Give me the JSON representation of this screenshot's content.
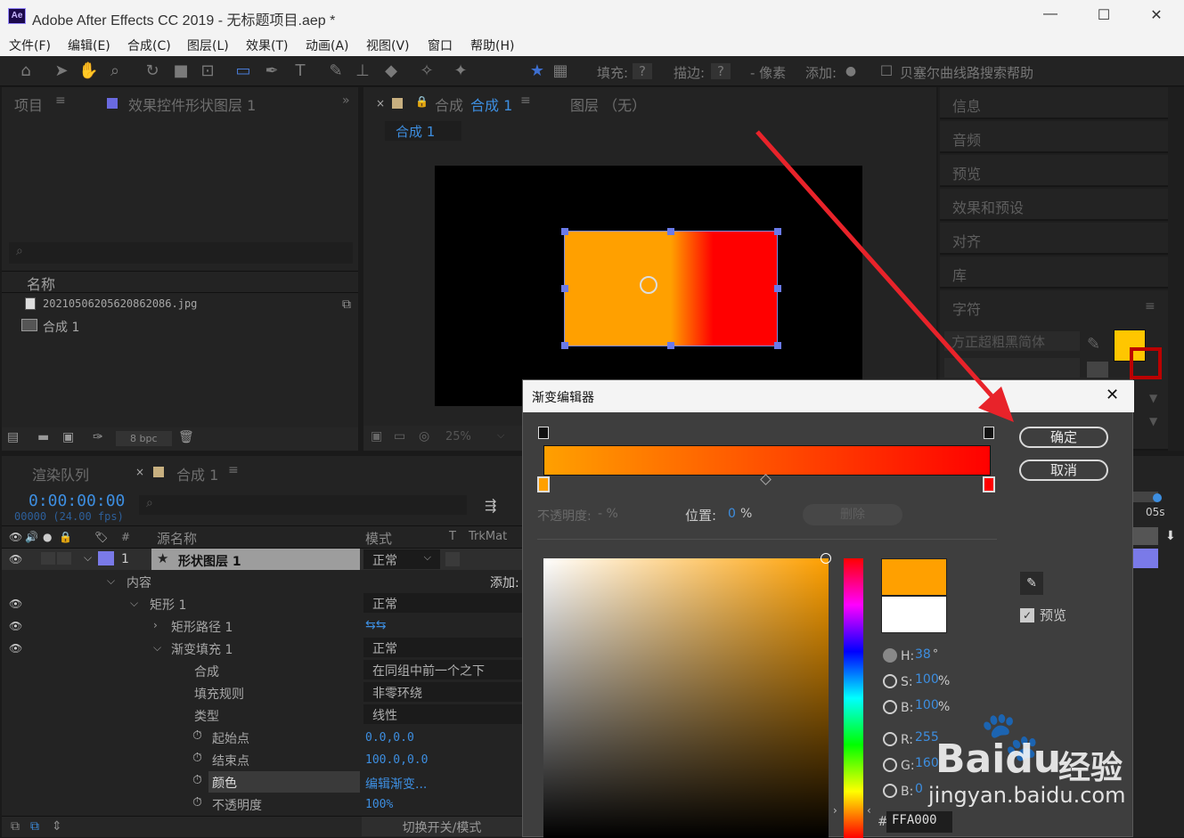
{
  "window": {
    "title": "Adobe After Effects CC 2019 - 无标题项目.aep *",
    "logo": "Ae"
  },
  "menu": [
    "文件(F)",
    "编辑(E)",
    "合成(C)",
    "图层(L)",
    "效果(T)",
    "动画(A)",
    "视图(V)",
    "窗口",
    "帮助(H)"
  ],
  "toolbar": {
    "fill_label": "填充:",
    "fill_value": "?",
    "stroke_label": "描边:",
    "stroke_value": "?",
    "px_label": "- 像素",
    "add_label": "添加:",
    "bezier": "贝塞尔曲线路",
    "search": "搜索帮助"
  },
  "project_panel": {
    "tab_project": "项目",
    "tab_effects": "效果控件形状图层 1",
    "col_name": "名称",
    "items": [
      {
        "name": "20210506205620862086.jpg"
      },
      {
        "name": "合成 1"
      }
    ],
    "bpc": "8 bpc"
  },
  "comp_panel": {
    "tab": "合成",
    "tab_name": "合成 1",
    "layer_tab": "图层 （无）",
    "breadcrumb": "合成 1",
    "zoom": "25%"
  },
  "right_panels": [
    "信息",
    "音频",
    "预览",
    "效果和预设",
    "对齐",
    "库",
    "字符"
  ],
  "character": {
    "font": "方正超粗黑简体"
  },
  "timeline": {
    "tab_render": "渲染队列",
    "tab_comp": "合成 1",
    "timecode": "0:00:00:00",
    "frame_info": "00000 (24.00 fps)",
    "col_source": "源名称",
    "col_mode": "模式",
    "col_t": "T",
    "col_trkmat": "TrkMat",
    "time_label": "05s",
    "bottom_label": "切换开关/模式",
    "layer": {
      "num": "1",
      "name": "形状图层 1",
      "mode": "正常"
    },
    "rows": [
      {
        "label": "内容",
        "value": "添加:"
      },
      {
        "label": "矩形 1",
        "value": "正常"
      },
      {
        "label": "矩形路径 1",
        "value": ""
      },
      {
        "label": "渐变填充 1",
        "value": "正常"
      },
      {
        "label": "合成",
        "value": "在同组中前一个之下"
      },
      {
        "label": "填充规则",
        "value": "非零环绕"
      },
      {
        "label": "类型",
        "value": "线性"
      },
      {
        "label": "起始点",
        "value": "0.0,0.0"
      },
      {
        "label": "结束点",
        "value": "100.0,0.0"
      },
      {
        "label": "颜色",
        "value": "编辑渐变..."
      },
      {
        "label": "不透明度",
        "value": "100%"
      }
    ]
  },
  "gradient_editor": {
    "title": "渐变编辑器",
    "ok": "确定",
    "cancel": "取消",
    "opacity_label": "不透明度:",
    "opacity_value": "- %",
    "position_label": "位置:",
    "position_value": "0",
    "position_unit": "%",
    "delete": "删除",
    "preview_label": "预览",
    "hsb": {
      "h_label": "H:",
      "h": "38",
      "h_unit": "°",
      "s_label": "S:",
      "s": "100",
      "s_unit": "%",
      "b_label": "B:",
      "b": "100",
      "b_unit": "%"
    },
    "rgb": {
      "r_label": "R:",
      "r": "255",
      "g_label": "G:",
      "g": "160",
      "b_label": "B:",
      "b": "0"
    },
    "hex_label": "#",
    "hex": "FFA000"
  },
  "colors": {
    "orange": "#FFA000",
    "red": "#FF0000",
    "accent": "#3d8ee0"
  },
  "watermark": {
    "brand": "Bai",
    "brand2": "du",
    "brand_cn": "经验",
    "url": "jingyan.baidu.com"
  }
}
